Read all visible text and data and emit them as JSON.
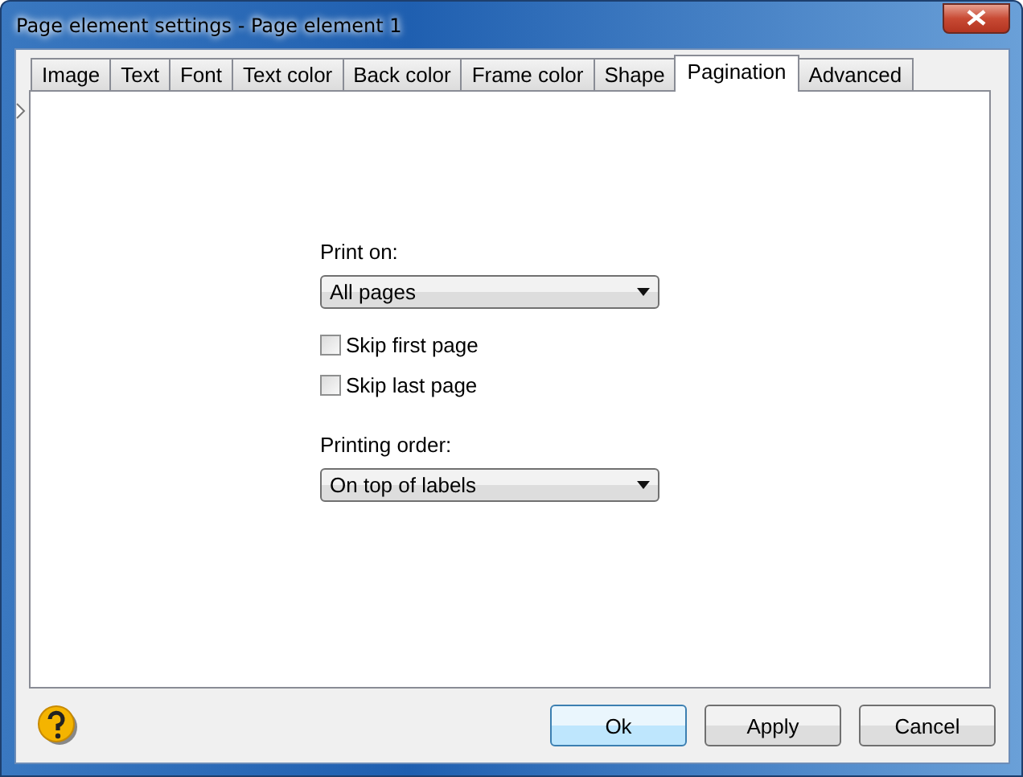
{
  "window": {
    "title": "Page element settings - Page element 1"
  },
  "tabs": [
    {
      "label": "Image",
      "selected": false
    },
    {
      "label": "Text",
      "selected": false
    },
    {
      "label": "Font",
      "selected": false
    },
    {
      "label": "Text color",
      "selected": false
    },
    {
      "label": "Back color",
      "selected": false
    },
    {
      "label": "Frame color",
      "selected": false
    },
    {
      "label": "Shape",
      "selected": false
    },
    {
      "label": "Pagination",
      "selected": true
    },
    {
      "label": "Advanced",
      "selected": false
    }
  ],
  "fields": [
    {
      "kind": "dropdown",
      "label": "Print on:",
      "value": "All pages"
    },
    {
      "kind": "checkbox",
      "label": "Skip first page",
      "checked": false
    },
    {
      "kind": "checkbox",
      "label": "Skip last page",
      "checked": false
    },
    {
      "kind": "dropdown",
      "label": "Printing order:",
      "value": "On top of labels"
    }
  ],
  "buttons": [
    {
      "label": "Ok",
      "default": true
    },
    {
      "label": "Apply",
      "default": false
    },
    {
      "label": "Cancel",
      "default": false
    }
  ]
}
